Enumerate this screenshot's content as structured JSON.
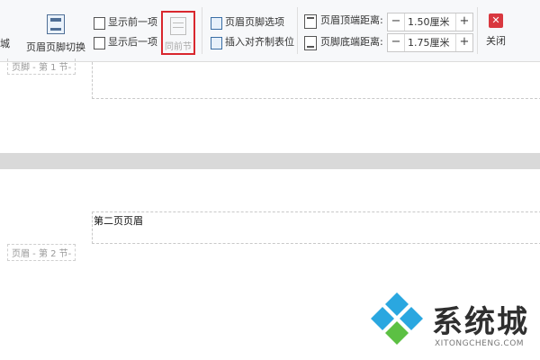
{
  "ribbon": {
    "partial_left_label": "城",
    "header_footer_switch": "页眉页脚切换",
    "show_previous": "显示前一项",
    "show_next": "显示后一项",
    "same_as_previous": "同前节",
    "header_footer_options": "页眉页脚选项",
    "insert_align_tab": "插入对齐制表位",
    "header_top_distance_label": "页眉顶端距离:",
    "header_top_distance_value": "1.50厘米",
    "footer_bottom_distance_label": "页脚底端距离:",
    "footer_bottom_distance_value": "1.75厘米",
    "minus": "−",
    "plus": "+",
    "close": "关闭",
    "close_glyph": "✕",
    "highlight_color": "#d9272e"
  },
  "document": {
    "footer_tag_section1": "页脚 - 第 1 节-",
    "header_tag_section2": "页眉 - 第 2 节-",
    "page2_header_text": "第二页页眉"
  },
  "watermark": {
    "brand": "系统城",
    "url": "XITONGCHENG.COM",
    "logo_colors": [
      "#2aa7e0",
      "#5cc043"
    ]
  }
}
